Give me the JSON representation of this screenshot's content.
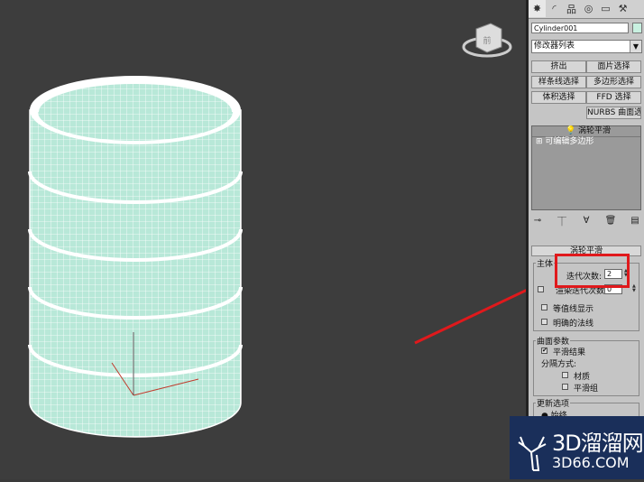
{
  "viewport": {
    "background": "#3d3d3d",
    "object": "cylinder",
    "viewcube_label": "前"
  },
  "toolbar": {
    "tabs": [
      {
        "icon": "sun-icon",
        "glyph": "✸"
      },
      {
        "icon": "modify-icon",
        "glyph": "◜"
      },
      {
        "icon": "hierarchy-icon",
        "glyph": "品"
      },
      {
        "icon": "motion-icon",
        "glyph": "◎"
      },
      {
        "icon": "display-icon",
        "glyph": "▭"
      },
      {
        "icon": "utilities-icon",
        "glyph": "⚒"
      }
    ]
  },
  "object_name": "Cylinder001",
  "modifier_list": "修改器列表",
  "buttons": [
    {
      "label": "挤出"
    },
    {
      "label": "面片选择"
    },
    {
      "label": "样条线选择"
    },
    {
      "label": "多边形选择"
    },
    {
      "label": "体积选择"
    },
    {
      "label": "FFD 选择"
    },
    {
      "label": "NURBS 曲面选择"
    }
  ],
  "stack": {
    "items": [
      "涡轮平滑",
      "可编辑多边形"
    ]
  },
  "rollout": {
    "title": "涡轮平滑",
    "main_group": "主体",
    "iterations_label": "迭代次数:",
    "iterations_value": "2",
    "render_iters_label": "渲染迭代次数:",
    "render_iters_value": "0",
    "isoline_label": "等值线显示",
    "explicit_normals_label": "明确的法线",
    "surface_group": "曲面参数",
    "smooth_result_label": "平滑结果",
    "separate_label": "分隔方式:",
    "materials_label": "材质",
    "smoothing_groups_label": "平滑组",
    "update_group": "更新选项",
    "always_label": "始终"
  },
  "watermark": {
    "line1": "3D溜溜网",
    "line2": "3D66.COM"
  },
  "colors": {
    "accent_red": "#e0191c",
    "mesh": "#b8e8d8",
    "wire": "#ffffff",
    "panel": "#c5c5c5"
  }
}
